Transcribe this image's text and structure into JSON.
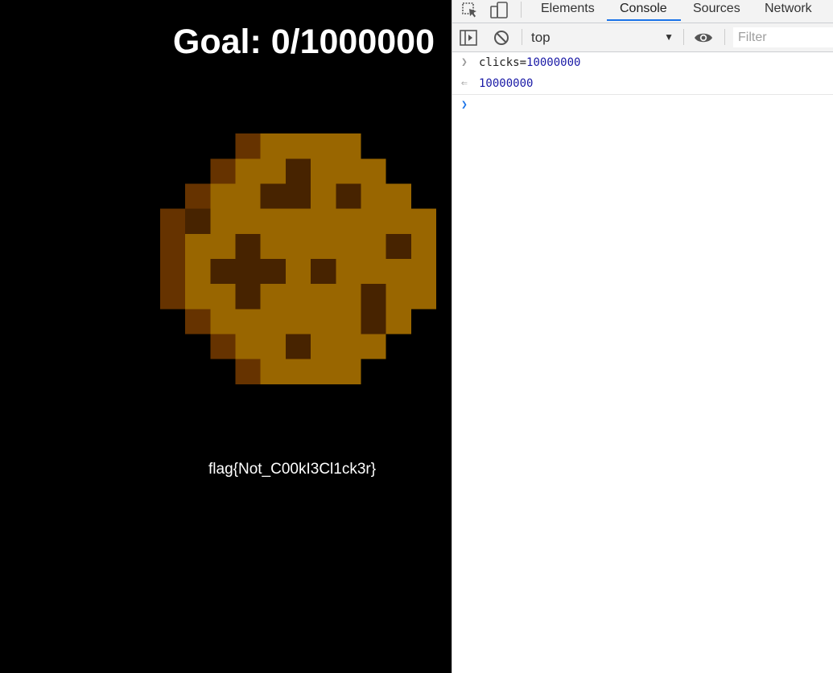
{
  "game": {
    "goal_text": "Goal: 0/1000000",
    "flag_text": "flag{Not_C00kI3Cl1ck3r}"
  },
  "devtools": {
    "tabs": [
      {
        "label": "Elements",
        "active": false
      },
      {
        "label": "Console",
        "active": true
      },
      {
        "label": "Sources",
        "active": false
      },
      {
        "label": "Network",
        "active": false
      }
    ],
    "toolbar": {
      "context": "top",
      "filter_placeholder": "Filter"
    },
    "console": {
      "input_line": {
        "prefix": "clicks=",
        "value": "10000000"
      },
      "result_line": "10000000"
    }
  },
  "colors": {
    "background": "#000000",
    "cookie_base": "#996600",
    "cookie_edge": "#663300",
    "cookie_chip": "#472300",
    "devtools_accent": "#1a73e8"
  }
}
